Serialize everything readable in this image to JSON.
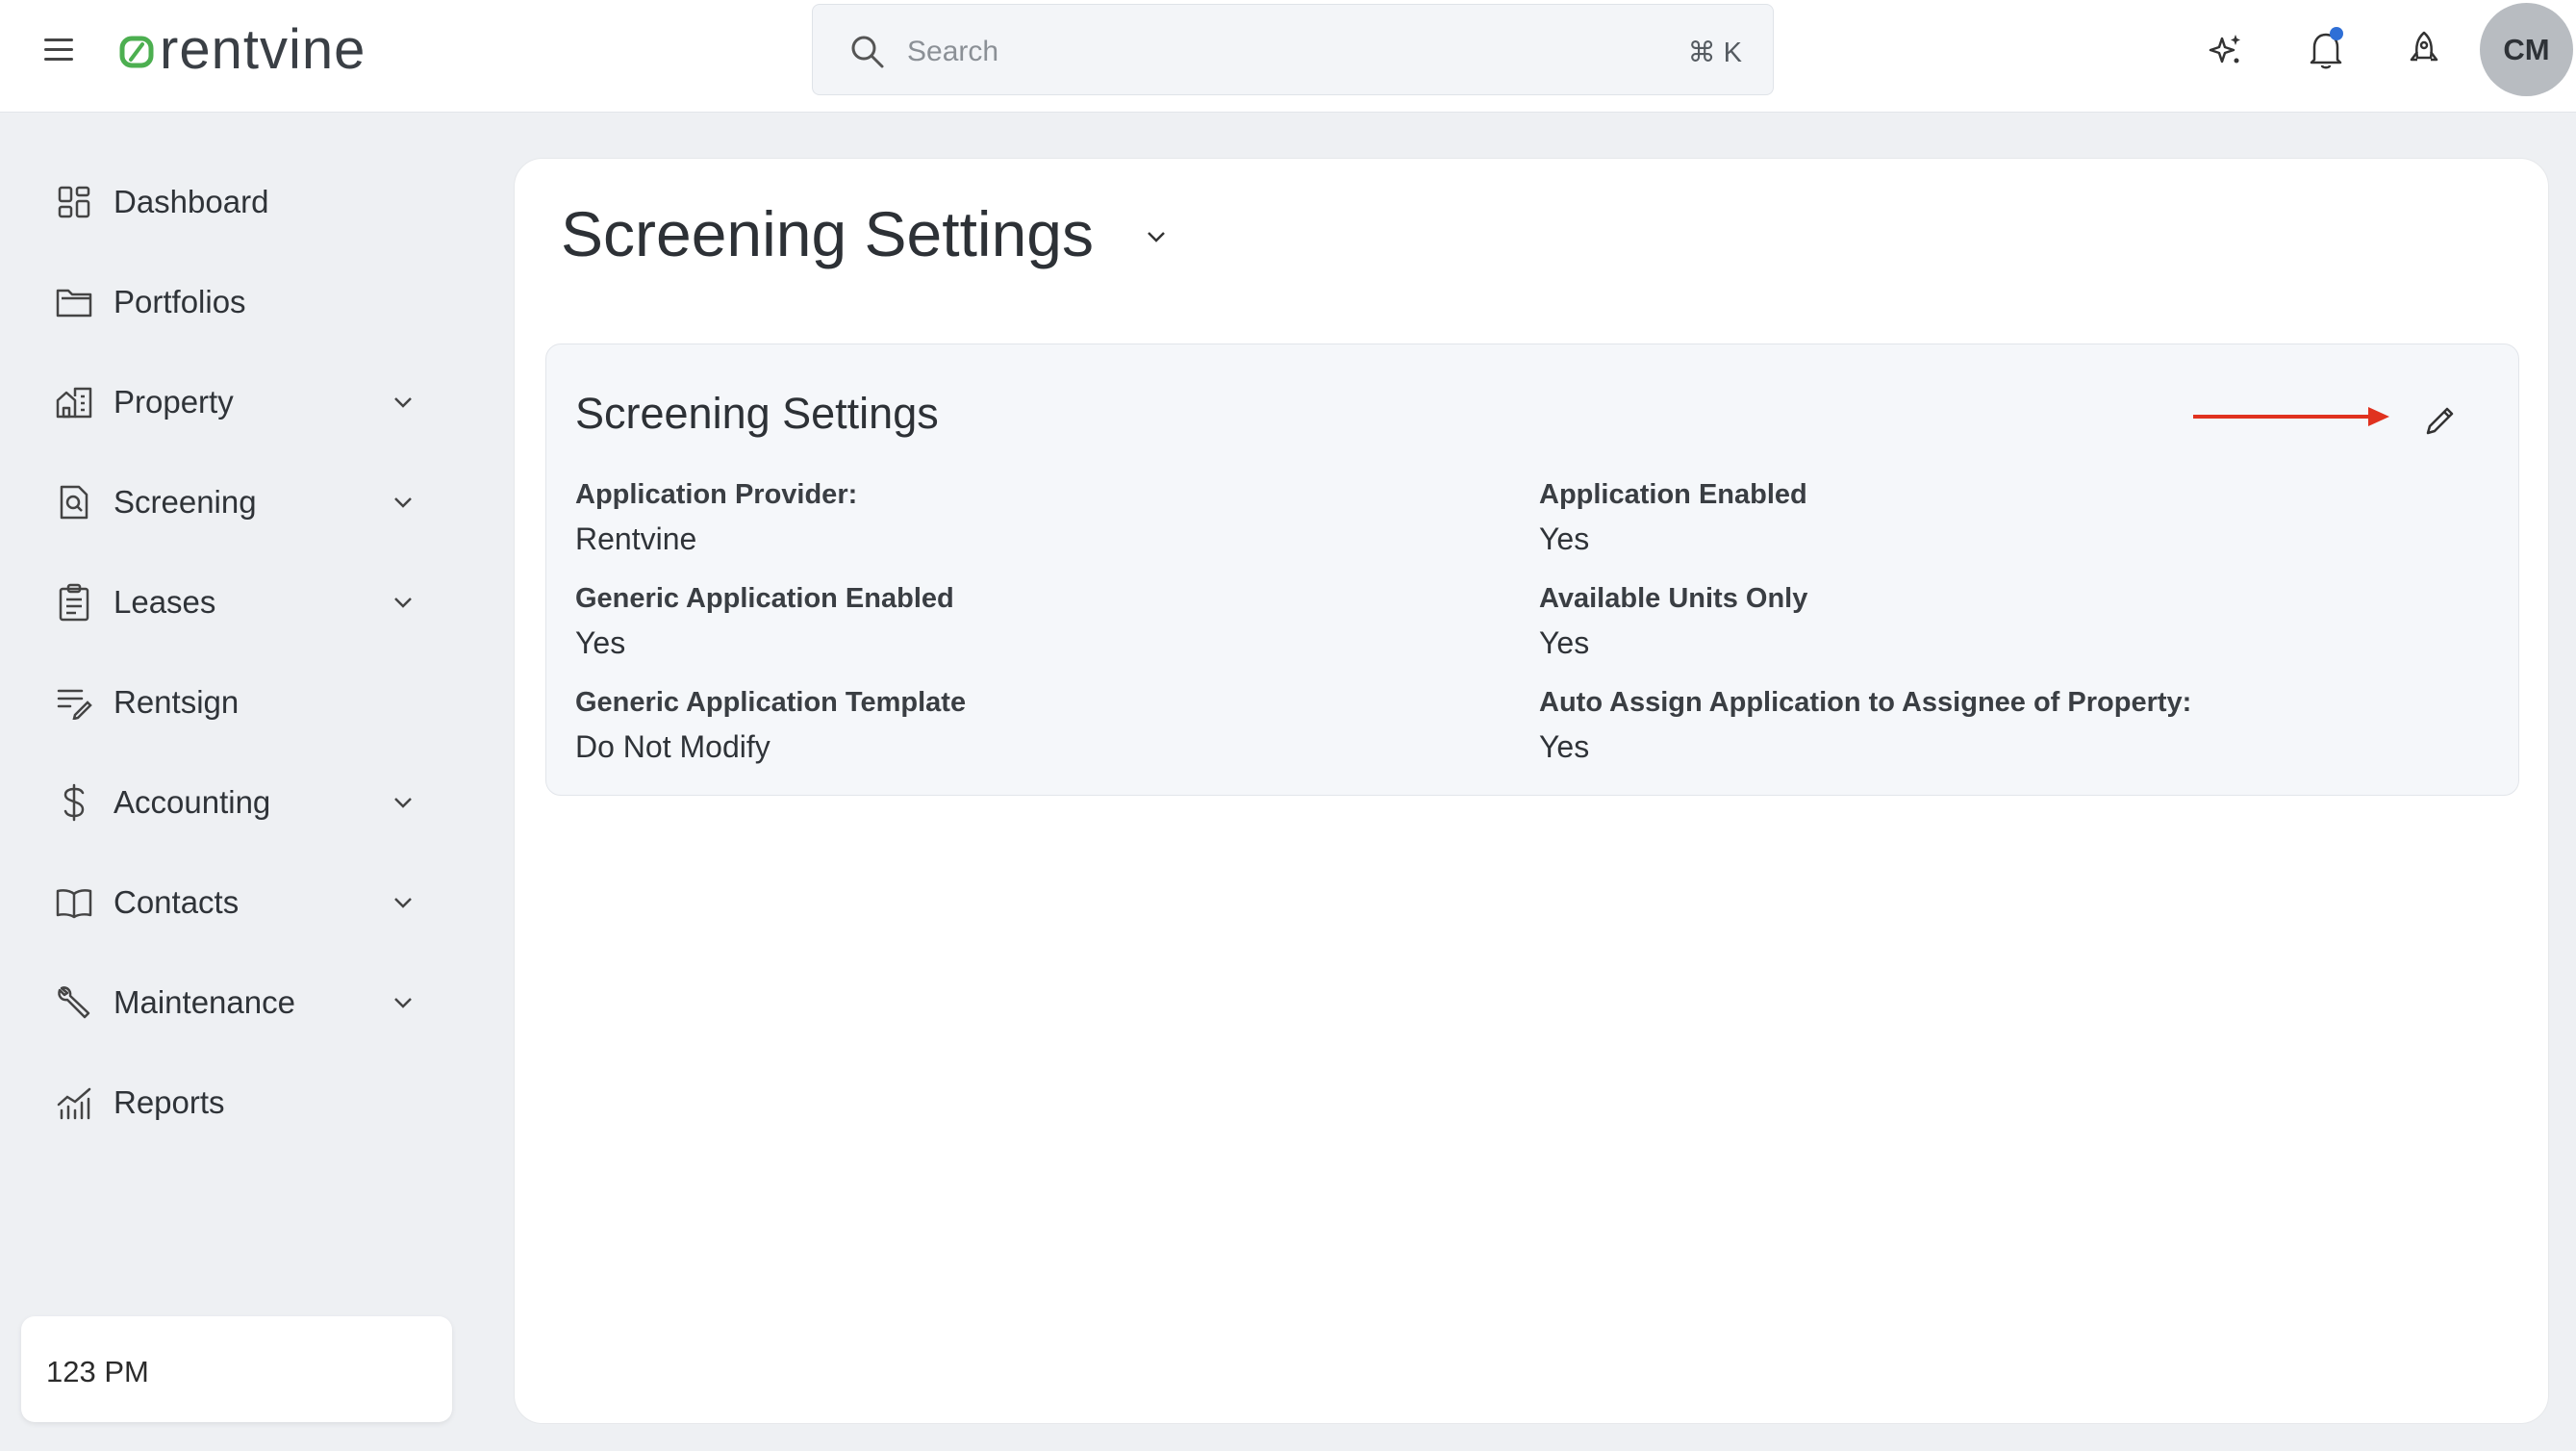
{
  "app": {
    "brand": "rentvine",
    "accent_color": "#4caf50",
    "notification_dot_color": "#2f6fd6",
    "annotation_arrow_color": "#e0321f"
  },
  "topbar": {
    "search": {
      "placeholder": "Search",
      "shortcut": "⌘ K"
    },
    "icons": [
      "menu-icon",
      "sparkle-icon",
      "bell-icon",
      "rocket-icon"
    ],
    "avatar_initials": "CM"
  },
  "sidebar": {
    "items": [
      {
        "label": "Dashboard",
        "icon": "dashboard-icon",
        "expandable": false
      },
      {
        "label": "Portfolios",
        "icon": "folder-icon",
        "expandable": false
      },
      {
        "label": "Property",
        "icon": "buildings-icon",
        "expandable": true
      },
      {
        "label": "Screening",
        "icon": "screening-doc-icon",
        "expandable": true
      },
      {
        "label": "Leases",
        "icon": "clipboard-icon",
        "expandable": true
      },
      {
        "label": "Rentsign",
        "icon": "sign-icon",
        "expandable": false
      },
      {
        "label": "Accounting",
        "icon": "dollar-icon",
        "expandable": true
      },
      {
        "label": "Contacts",
        "icon": "book-icon",
        "expandable": true
      },
      {
        "label": "Maintenance",
        "icon": "wrench-icon",
        "expandable": true
      },
      {
        "label": "Reports",
        "icon": "chart-icon",
        "expandable": false
      }
    ],
    "footer_text": "123 PM"
  },
  "page": {
    "title": "Screening Settings"
  },
  "card": {
    "title": "Screening Settings",
    "fields": [
      {
        "label": "Application Provider:",
        "value": "Rentvine"
      },
      {
        "label": "Application Enabled",
        "value": "Yes"
      },
      {
        "label": "Generic Application Enabled",
        "value": "Yes"
      },
      {
        "label": "Available Units Only",
        "value": "Yes"
      },
      {
        "label": "Generic Application Template",
        "value": "Do Not Modify"
      },
      {
        "label": "Auto Assign Application to Assignee of Property:",
        "value": "Yes"
      }
    ]
  }
}
